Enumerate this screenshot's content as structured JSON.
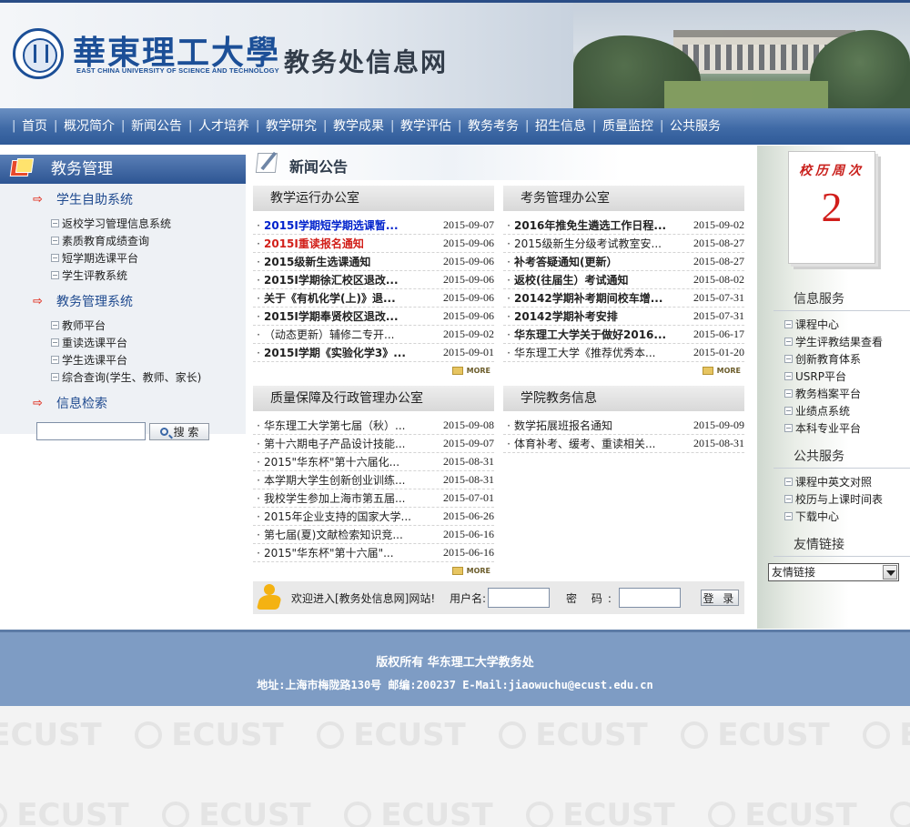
{
  "header": {
    "university_cn": "華東理工大學",
    "university_en": "EAST CHINA UNIVERSITY OF SCIENCE AND TECHNOLOGY",
    "site_title": "教务处信息网"
  },
  "nav": [
    "首页",
    "概况简介",
    "新闻公告",
    "人才培养",
    "教学研究",
    "教学成果",
    "教学评估",
    "教务考务",
    "招生信息",
    "质量监控",
    "公共服务"
  ],
  "left": {
    "title": "教务管理",
    "sections": [
      {
        "title": "学生自助系统",
        "links": [
          "返校学习管理信息系统",
          "素质教育成绩查询",
          "短学期选课平台",
          "学生评教系统"
        ]
      },
      {
        "title": "教务管理系统",
        "links": [
          "教师平台",
          "重读选课平台",
          "学生选课平台",
          "综合查询(学生、教师、家长)"
        ]
      },
      {
        "title": "信息检索",
        "links": []
      }
    ],
    "search_button": "搜 索",
    "search_value": ""
  },
  "center": {
    "title": "新闻公告",
    "more_label": "MORE",
    "boxes": [
      {
        "title": "教学运行办公室",
        "items": [
          {
            "t": "2015I学期短学期选课暂...",
            "d": "2015-09-07",
            "s": "blue"
          },
          {
            "t": "2015I重读报名通知",
            "d": "2015-09-06",
            "s": "red"
          },
          {
            "t": "2015级新生选课通知",
            "d": "2015-09-06",
            "s": "bold"
          },
          {
            "t": "2015I学期徐汇校区退改...",
            "d": "2015-09-06",
            "s": "bold"
          },
          {
            "t": "关于《有机化学(上)》退...",
            "d": "2015-09-06",
            "s": "bold"
          },
          {
            "t": "2015I学期奉贤校区退改...",
            "d": "2015-09-06",
            "s": "bold"
          },
          {
            "t": "（动态更新）辅修二专开...",
            "d": "2015-09-02",
            "s": ""
          },
          {
            "t": "2015I学期《实验化学3》...",
            "d": "2015-09-01",
            "s": "bold"
          }
        ]
      },
      {
        "title": "考务管理办公室",
        "items": [
          {
            "t": "2016年推免生遴选工作日程...",
            "d": "2015-09-02",
            "s": "bold"
          },
          {
            "t": "2015级新生分级考试教室安...",
            "d": "2015-08-27",
            "s": ""
          },
          {
            "t": "补考答疑通知(更新）",
            "d": "2015-08-27",
            "s": "bold"
          },
          {
            "t": "返校(往届生）考试通知",
            "d": "2015-08-02",
            "s": "bold"
          },
          {
            "t": "20142学期补考期间校车增...",
            "d": "2015-07-31",
            "s": "bold"
          },
          {
            "t": "20142学期补考安排",
            "d": "2015-07-31",
            "s": "bold"
          },
          {
            "t": "华东理工大学关于做好2016...",
            "d": "2015-06-17",
            "s": "bold"
          },
          {
            "t": "华东理工大学《推荐优秀本...",
            "d": "2015-01-20",
            "s": ""
          }
        ]
      },
      {
        "title": "质量保障及行政管理办公室",
        "items": [
          {
            "t": "华东理工大学第七届（秋）...",
            "d": "2015-09-08",
            "s": ""
          },
          {
            "t": "第十六期电子产品设计技能...",
            "d": "2015-09-07",
            "s": ""
          },
          {
            "t": "2015\"华东杯\"第十六届化...",
            "d": "2015-08-31",
            "s": ""
          },
          {
            "t": "本学期大学生创新创业训练...",
            "d": "2015-08-31",
            "s": ""
          },
          {
            "t": "我校学生参加上海市第五届...",
            "d": "2015-07-01",
            "s": ""
          },
          {
            "t": "2015年企业支持的国家大学...",
            "d": "2015-06-26",
            "s": ""
          },
          {
            "t": "第七届(夏)文献检索知识竞...",
            "d": "2015-06-16",
            "s": ""
          },
          {
            "t": "2015\"华东杯\"第十六届\"...",
            "d": "2015-06-16",
            "s": ""
          }
        ]
      },
      {
        "title": "学院教务信息",
        "items": [
          {
            "t": "数学拓展班报名通知",
            "d": "2015-09-09",
            "s": ""
          },
          {
            "t": "体育补考、缓考、重读相关...",
            "d": "2015-08-31",
            "s": ""
          }
        ]
      }
    ],
    "welcome": {
      "text": "欢迎进入[教务处信息网]网站!",
      "username_label": "用户名:",
      "password_label": "密 码:",
      "login_button": "登 录"
    }
  },
  "right": {
    "calendar_label": "校历周次",
    "calendar_week": "2",
    "info_title": "信息服务",
    "info_links": [
      "课程中心",
      "学生评教结果查看",
      "创新教育体系",
      "USRP平台",
      "教务档案平台",
      "业绩点系统",
      "本科专业平台"
    ],
    "public_title": "公共服务",
    "public_links": [
      "课程中英文对照",
      "校历与上课时间表",
      "下载中心"
    ],
    "friend_title": "友情链接",
    "friend_select": "友情链接"
  },
  "footer": {
    "line1": "版权所有 华东理工大学教务处",
    "line2": "地址:上海市梅陇路130号 邮编:200237 E-Mail:jiaowuchu@ecust.edu.cn"
  },
  "watermark": "ECUST"
}
